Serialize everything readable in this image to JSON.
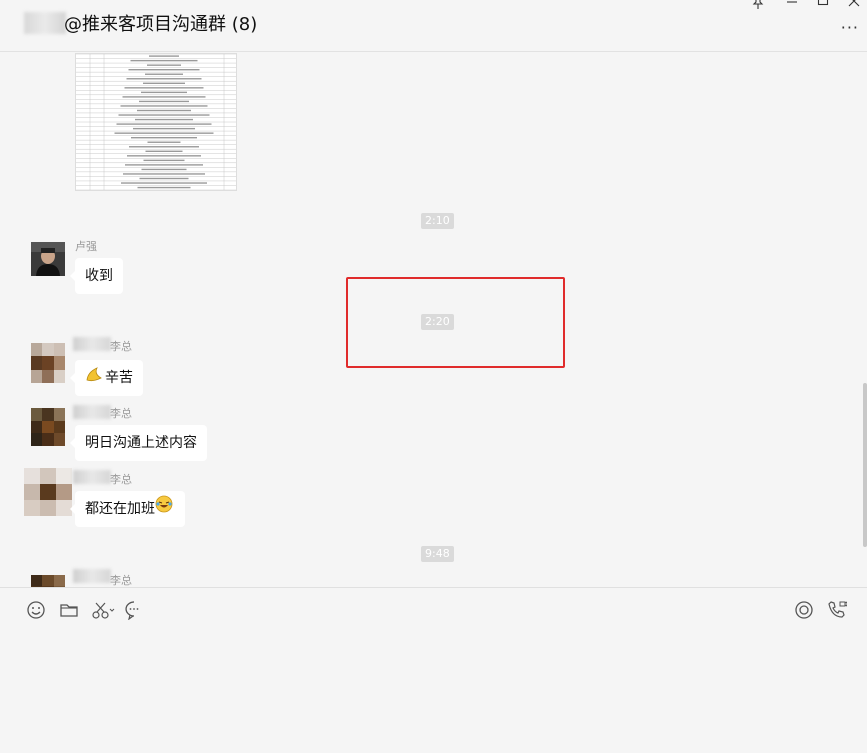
{
  "header": {
    "title": "@推来客项目沟通群 (8)",
    "more_label": "···"
  },
  "messages": {
    "time_1": "2:10",
    "m1_sender": "卢强",
    "m1_text": "收到",
    "time_2": "2:20",
    "m2_sender": "李总",
    "m2_text": "辛苦",
    "m3_sender": "李总",
    "m3_text": "明日沟通上述内容",
    "m4_sender": "李总",
    "m4_text": "都还在加班",
    "time_3": "9:48",
    "m5_sender": "李总"
  },
  "toolbar": {
    "icons": [
      "emoji-icon",
      "folder-icon",
      "scissors-icon",
      "chat-history-icon",
      "live-icon",
      "call-icon"
    ]
  },
  "colors": {
    "highlight_box": "#e02b2b",
    "time_badge": "#dadada",
    "background": "#f5f5f5"
  }
}
